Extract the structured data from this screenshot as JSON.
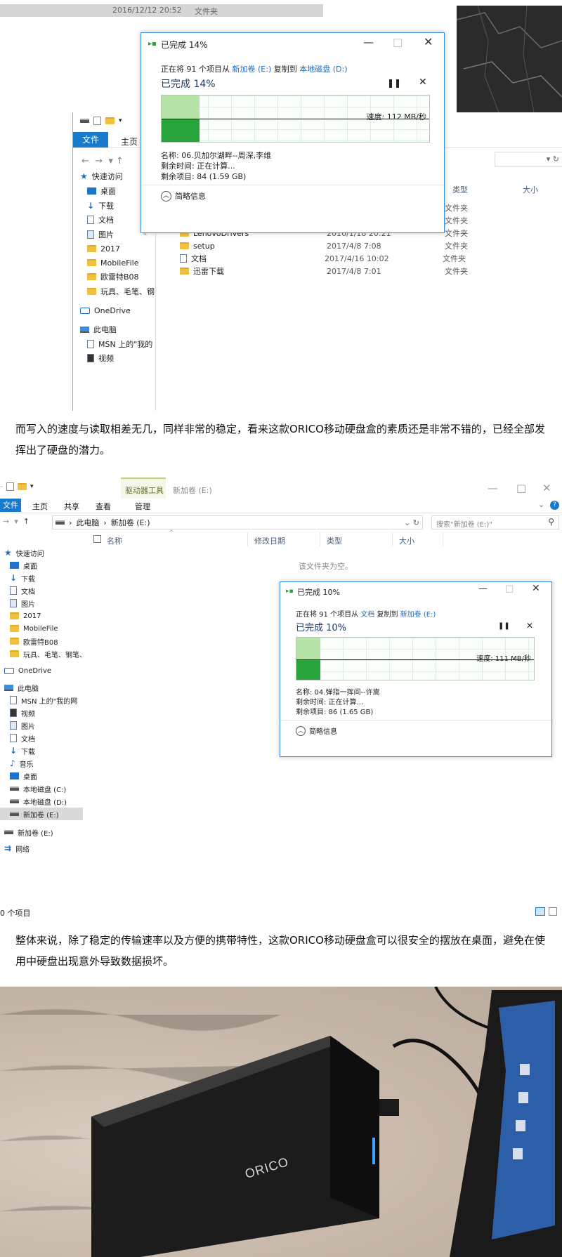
{
  "shot1": {
    "date_strip": {
      "date": "2016/12/12 20:52",
      "type": "文件夹"
    },
    "explorer": {
      "ribbon_tabs": [
        "文件",
        "主页"
      ],
      "sidebar": [
        {
          "label": "快速访问",
          "icon": "star"
        },
        {
          "label": "桌面",
          "icon": "desktop",
          "pinned": false
        },
        {
          "label": "下载",
          "icon": "download"
        },
        {
          "label": "文档",
          "icon": "document",
          "pinned": true
        },
        {
          "label": "图片",
          "icon": "picture",
          "pinned": true
        },
        {
          "label": "2017",
          "icon": "folder"
        },
        {
          "label": "MobileFile",
          "icon": "folder"
        },
        {
          "label": "欧雷特B08",
          "icon": "folder"
        },
        {
          "label": "玩具、毛笔、钢",
          "icon": "folder"
        },
        {
          "label": "OneDrive",
          "icon": "onedrive"
        },
        {
          "label": "此电脑",
          "icon": "pc"
        },
        {
          "label": "MSN 上的\"我的",
          "icon": "document"
        },
        {
          "label": "视频",
          "icon": "video"
        }
      ],
      "columns": {
        "type": "类型",
        "size": "大小"
      },
      "files": [
        {
          "name": "",
          "date": "",
          "type": "文件夹"
        },
        {
          "name": "",
          "date": "",
          "type": "文件夹"
        },
        {
          "name": "LenovoDrivers",
          "date": "2016/1/18 20:21",
          "type": "文件夹"
        },
        {
          "name": "setup",
          "date": "2017/4/8 7:08",
          "type": "文件夹"
        },
        {
          "name": "文档",
          "date": "2017/4/16 10:02",
          "type": "文件夹"
        },
        {
          "name": "迅雷下载",
          "date": "2017/4/8 7:01",
          "type": "文件夹"
        }
      ]
    },
    "dialog": {
      "title": "已完成 14%",
      "from_prefix": "正在将 91 个项目从",
      "from": "新加卷 (E:)",
      "to_word": "复制到",
      "to": "本地磁盘 (D:)",
      "progress_label": "已完成 14%",
      "progress": 0.14,
      "speed": "速度: 112 MB/秒",
      "name": "名称: 06.贝加尔湖畔--周深,李维",
      "time_left": "剩余时间: 正在计算...",
      "items_left": "剩余项目: 84 (1.59 GB)",
      "less_info": "简略信息"
    }
  },
  "para1": "而写入的速度与读取相差无几，同样非常的稳定，看来这款ORICO移动硬盘盒的素质还是非常不错的，已经全部发挥出了硬盘的潜力。",
  "shot2": {
    "title": "新加卷 (E:)",
    "context_tab": "驱动器工具",
    "ribbon_tabs": [
      "文件",
      "主页",
      "共享",
      "查看",
      "管理"
    ],
    "path": [
      "此电脑",
      "新加卷 (E:)"
    ],
    "search_placeholder": "搜索\"新加卷 (E:)\"",
    "columns": {
      "name": "名称",
      "date": "修改日期",
      "type": "类型",
      "size": "大小"
    },
    "empty_text": "该文件夹为空。",
    "sidebar": [
      {
        "label": "快速访问",
        "icon": "star"
      },
      {
        "label": "桌面",
        "icon": "desktop"
      },
      {
        "label": "下载",
        "icon": "download"
      },
      {
        "label": "文档",
        "icon": "document"
      },
      {
        "label": "图片",
        "icon": "picture"
      },
      {
        "label": "2017",
        "icon": "folder"
      },
      {
        "label": "MobileFile",
        "icon": "folder"
      },
      {
        "label": "欧雷特B08",
        "icon": "folder"
      },
      {
        "label": "玩具、毛笔、钢笔、",
        "icon": "folder"
      },
      {
        "label": "OneDrive",
        "icon": "onedrive"
      },
      {
        "label": "此电脑",
        "icon": "pc"
      },
      {
        "label": "MSN 上的\"我的网",
        "icon": "document"
      },
      {
        "label": "视频",
        "icon": "video"
      },
      {
        "label": "图片",
        "icon": "picture"
      },
      {
        "label": "文档",
        "icon": "document"
      },
      {
        "label": "下载",
        "icon": "download"
      },
      {
        "label": "音乐",
        "icon": "music"
      },
      {
        "label": "桌面",
        "icon": "desktop"
      },
      {
        "label": "本地磁盘 (C:)",
        "icon": "drive"
      },
      {
        "label": "本地磁盘 (D:)",
        "icon": "drive"
      },
      {
        "label": "新加卷 (E:)",
        "icon": "drive",
        "selected": true
      },
      {
        "label": "新加卷 (E:)",
        "icon": "drive"
      },
      {
        "label": "网络",
        "icon": "network"
      }
    ],
    "status": "0 个项目",
    "dialog": {
      "title": "已完成 10%",
      "from_prefix": "正在将 91 个项目从",
      "from": "文档",
      "to_word": "复制到",
      "to": "新加卷 (E:)",
      "progress_label": "已完成 10%",
      "progress": 0.1,
      "speed": "速度: 111 MB/秒",
      "name": "名称: 04.弹指一挥间--许嵩",
      "time_left": "剩余时间: 正在计算...",
      "items_left": "剩余项目: 86 (1.65 GB)",
      "less_info": "简略信息"
    }
  },
  "para2": "整体来说，除了稳定的传输速率以及方便的携带特性，这款ORICO移动硬盘盒可以很安全的摆放在桌面，避免在使用中硬盘出现意外导致数据损坏。",
  "photo": {
    "brand": "ORICO"
  }
}
